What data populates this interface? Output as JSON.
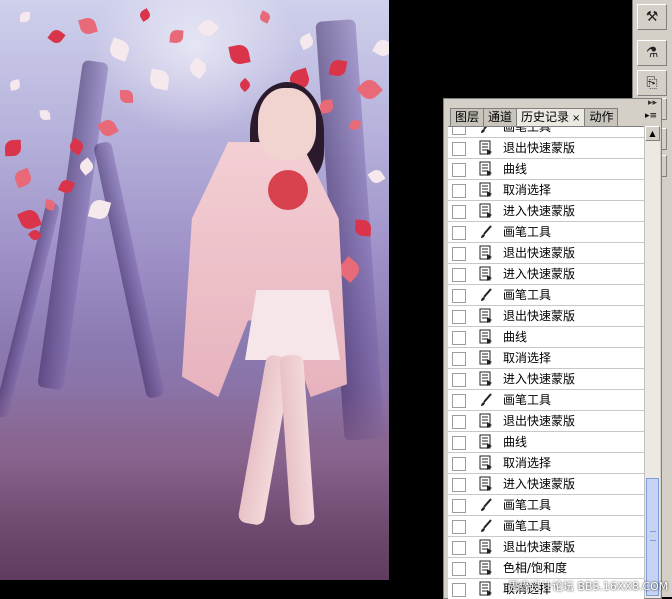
{
  "panel": {
    "tabs": [
      {
        "label": "图层",
        "active": false
      },
      {
        "label": "通道",
        "active": false
      },
      {
        "label": "历史记录",
        "active": true,
        "close": "×"
      },
      {
        "label": "动作",
        "active": false
      }
    ],
    "history": [
      {
        "label": "画笔工具",
        "icon": "brush-icon"
      },
      {
        "label": "退出快速蒙版",
        "icon": "document-icon"
      },
      {
        "label": "曲线",
        "icon": "document-icon"
      },
      {
        "label": "取消选择",
        "icon": "document-icon"
      },
      {
        "label": "进入快速蒙版",
        "icon": "document-icon"
      },
      {
        "label": "画笔工具",
        "icon": "brush-icon"
      },
      {
        "label": "退出快速蒙版",
        "icon": "document-icon"
      },
      {
        "label": "进入快速蒙版",
        "icon": "document-icon"
      },
      {
        "label": "画笔工具",
        "icon": "brush-icon"
      },
      {
        "label": "退出快速蒙版",
        "icon": "document-icon"
      },
      {
        "label": "曲线",
        "icon": "document-icon"
      },
      {
        "label": "取消选择",
        "icon": "document-icon"
      },
      {
        "label": "进入快速蒙版",
        "icon": "document-icon"
      },
      {
        "label": "画笔工具",
        "icon": "brush-icon"
      },
      {
        "label": "退出快速蒙版",
        "icon": "document-icon"
      },
      {
        "label": "曲线",
        "icon": "document-icon"
      },
      {
        "label": "取消选择",
        "icon": "document-icon"
      },
      {
        "label": "进入快速蒙版",
        "icon": "document-icon"
      },
      {
        "label": "画笔工具",
        "icon": "brush-icon"
      },
      {
        "label": "画笔工具",
        "icon": "brush-icon"
      },
      {
        "label": "退出快速蒙版",
        "icon": "document-icon"
      },
      {
        "label": "色相/饱和度",
        "icon": "document-icon"
      },
      {
        "label": "取消选择",
        "icon": "document-icon"
      },
      {
        "label": "",
        "icon": "document-icon",
        "selected": true
      }
    ]
  },
  "watermark": "思缘设计论坛 BBS.16XX8.COM",
  "colors": {
    "selection": "#30509c",
    "panel_bg": "#d4d0c8"
  }
}
